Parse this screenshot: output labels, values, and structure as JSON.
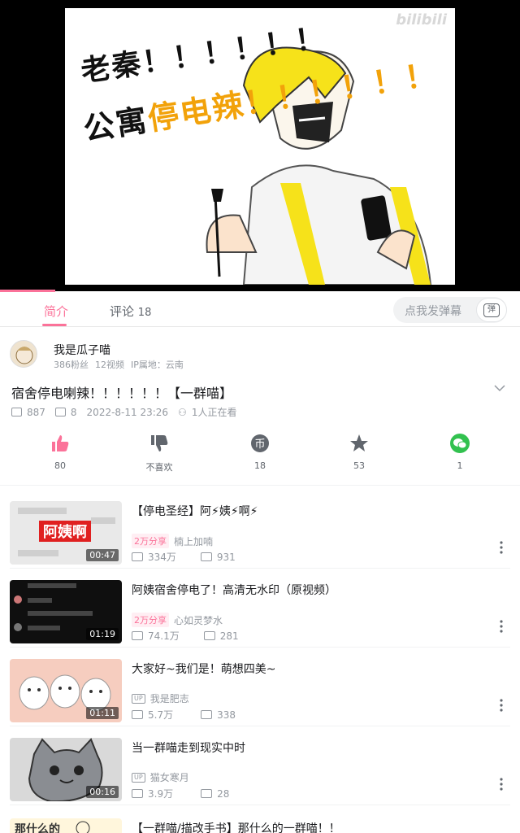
{
  "player": {
    "caption_line1": "老秦！！！！！！",
    "caption_line2_prefix": "公寓",
    "caption_line2_highlight": "停电辣",
    "caption_line2_suffix": "！！！！！！",
    "watermark": "bilibili",
    "progress_percent": 10.6
  },
  "tabs": {
    "intro": "简介",
    "comments": "评论",
    "comment_count": "18",
    "danmaku_placeholder": "点我发弹幕",
    "danmaku_icon_text": "弹"
  },
  "uploader": {
    "name": "我是瓜子喵",
    "fans": "386粉丝",
    "videos": "12视频",
    "ip": "IP属地：云南"
  },
  "video": {
    "title": "宿舍停电喇辣！！！！！！【一群喵】",
    "plays": "887",
    "danmaku": "8",
    "date": "2022-8-11 23:26",
    "watching": "1人正在看"
  },
  "actions": [
    {
      "label": "80",
      "icon": "thumbs-up-icon"
    },
    {
      "label": "不喜欢",
      "icon": "thumbs-down-icon"
    },
    {
      "label": "18",
      "icon": "coin-icon"
    },
    {
      "label": "53",
      "icon": "star-icon"
    },
    {
      "label": "1",
      "icon": "wechat-icon"
    }
  ],
  "related": [
    {
      "title": "【停电圣经】阿⚡姨⚡啊⚡",
      "badge": "2万分享",
      "up": "楠上加喃",
      "plays": "334万",
      "danmaku": "931",
      "duration": "00:47"
    },
    {
      "title": "阿姨宿舍停电了！高清无水印（原视频）",
      "badge": "2万分享",
      "up": "心如灵梦水",
      "plays": "74.1万",
      "danmaku": "281",
      "duration": "01:19"
    },
    {
      "title": "大家好~我们是！萌想四美~",
      "badge": "",
      "up_badge": "UP",
      "up": "我是肥志",
      "plays": "5.7万",
      "danmaku": "338",
      "duration": "01:11"
    },
    {
      "title": "当一群喵走到现实中时",
      "badge": "",
      "up_badge": "UP",
      "up": "猫女寒月",
      "plays": "3.9万",
      "danmaku": "28",
      "duration": "00:16"
    },
    {
      "title": "【一群喵/描改手书】那什么的一群喵！！"
    }
  ],
  "colors": {
    "accent": "#fb7299",
    "highlight": "#f2a20a",
    "text": "#18191c",
    "muted": "#9499a0"
  }
}
